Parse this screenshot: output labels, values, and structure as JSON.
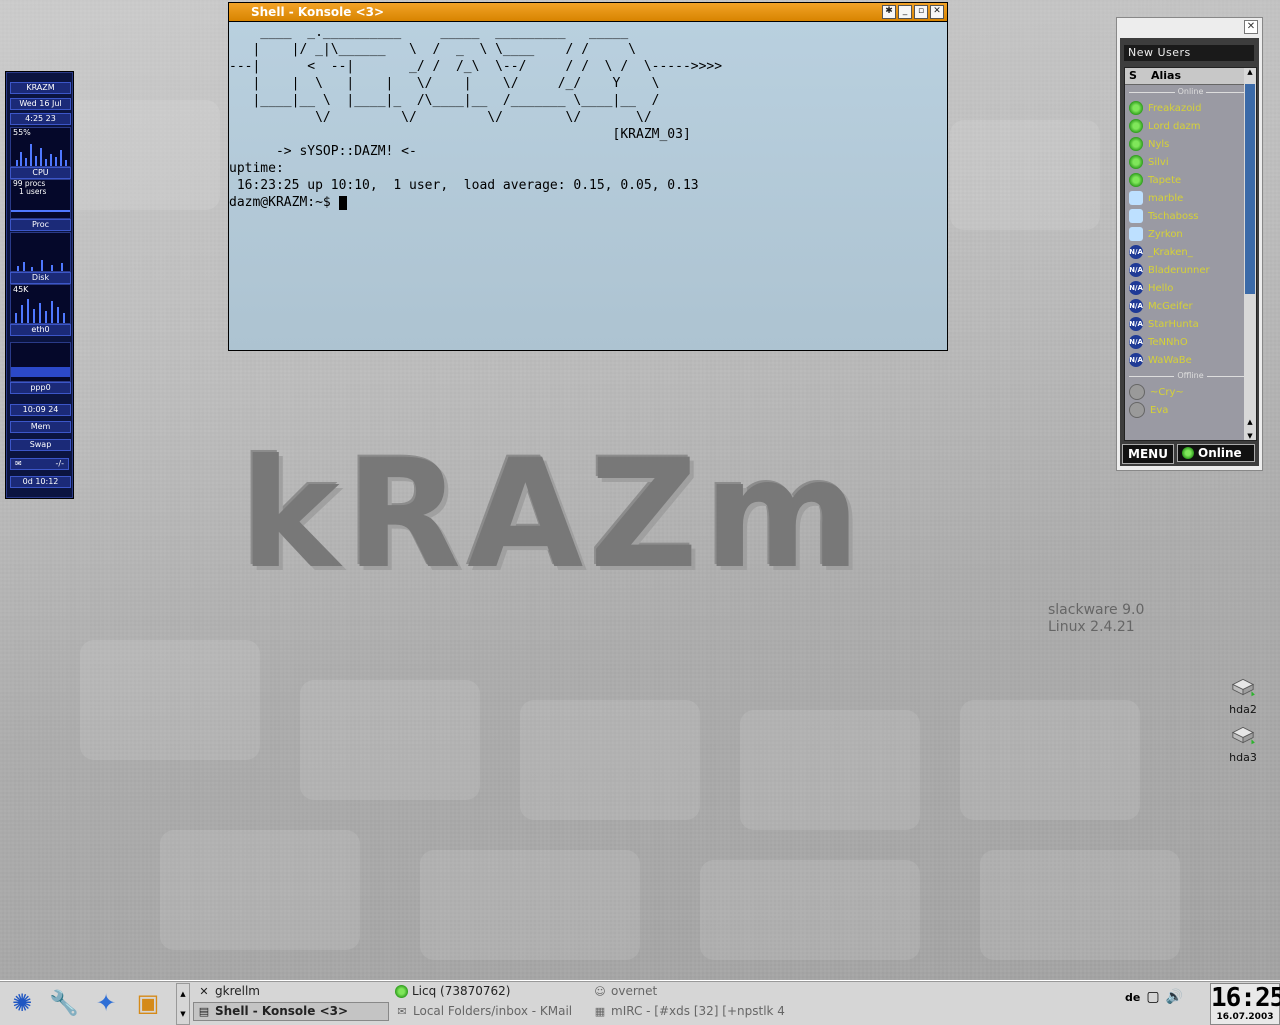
{
  "gkrellm": {
    "host": "KRAZM",
    "date": "Wed 16 Jul",
    "time": "4:25  23",
    "cpu_pct": "55%",
    "cpu_label": "CPU",
    "procs": "99 procs",
    "users": "1 users",
    "proc_label": "Proc",
    "disk_label": "Disk",
    "net_rate": "45K",
    "eth_label": "eth0",
    "ppp_label": "ppp0",
    "ppp_time": "10:09  24",
    "mem_label": "Mem",
    "swap_label": "Swap",
    "mail_count": "-/-",
    "uptime": "0d 10:12"
  },
  "konsole": {
    "title": "Shell - Konsole <3>",
    "ascii": "    ____  _.__________     _____  _________   _____\n   |    |/ _|\\______   \\  /  _  \\ \\____    / /     \\\n---|      <  --|       _/ /  /_\\  \\--/     / /  \\ /  \\----->>>>\n   |    |  \\   |    |   \\/    |    \\/     /_/    Y    \\\n   |____|__ \\  |____|_  /\\____|__  /_______ \\____|__  /\n           \\/         \\/         \\/        \\/       \\/\n                                                 [KRAZM_03]",
    "sysop": "      -> sYSOP::DAZM! <-",
    "uptime_cmd": "uptime:",
    "uptime_out": " 16:23:25 up 10:10,  1 user,  load average: 0.15, 0.05, 0.13",
    "prompt": "dazm@KRAZM:~$ "
  },
  "licq": {
    "new_users": "New Users",
    "col_s": "S",
    "col_alias": "Alias",
    "online_sep": "Online",
    "offline_sep": "Offline",
    "contacts": [
      {
        "name": "Freakazoid",
        "status": "online"
      },
      {
        "name": "Lord dazm",
        "status": "online"
      },
      {
        "name": "Nyls",
        "status": "online"
      },
      {
        "name": "Silvi",
        "status": "online"
      },
      {
        "name": "Tapete",
        "status": "online"
      },
      {
        "name": "marble",
        "status": "away"
      },
      {
        "name": "Tschaboss",
        "status": "away"
      },
      {
        "name": "Zyrkon",
        "status": "away"
      },
      {
        "name": "_Kraken_",
        "status": "na"
      },
      {
        "name": "Bladerunner",
        "status": "na"
      },
      {
        "name": "Hello",
        "status": "na"
      },
      {
        "name": "McGeifer",
        "status": "na"
      },
      {
        "name": "StarHunta",
        "status": "na"
      },
      {
        "name": "TeNNhO",
        "status": "na"
      },
      {
        "name": "WaWaBe",
        "status": "na"
      }
    ],
    "offline": [
      {
        "name": "~Cry~",
        "status": "offline"
      },
      {
        "name": "Eva",
        "status": "offline"
      }
    ],
    "menu_label": "MENU",
    "status_label": "Online"
  },
  "desktop": {
    "logo": "kRAZm",
    "os_line1": "slackware 9.0",
    "os_line2": "Linux 2.4.21",
    "icons": [
      {
        "label": "hda2"
      },
      {
        "label": "hda3"
      }
    ]
  },
  "taskbar": {
    "tasks": [
      {
        "label": "gkrellm",
        "icon": "x-icon"
      },
      {
        "label": "Shell - Konsole <3>",
        "icon": "konsole-icon"
      },
      {
        "label": "Licq (73870762)",
        "icon": "licq-flower-icon"
      },
      {
        "label": "Local Folders/inbox - KMail",
        "icon": "kmail-icon"
      },
      {
        "label": "overnet",
        "icon": "overnet-icon"
      },
      {
        "label": "mIRC - [#xds [32] [+npstlk 4",
        "icon": "mirc-icon"
      }
    ],
    "keyboard_layout": "de",
    "clock_time": "16:25",
    "clock_date": "16.07.2003"
  }
}
